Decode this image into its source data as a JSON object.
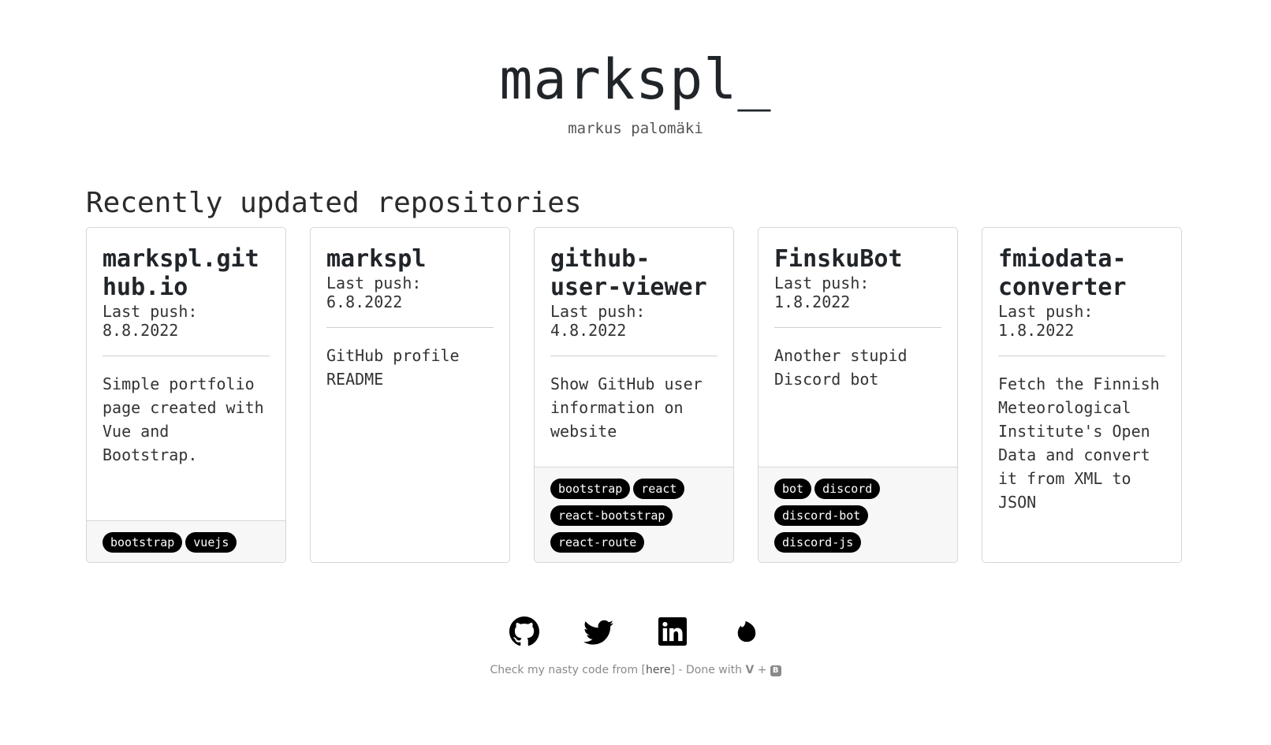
{
  "header": {
    "title": "markspl_",
    "subtitle": "markus palomäki"
  },
  "section": {
    "title": "Recently updated repositories"
  },
  "repos": [
    {
      "name": "markspl.github.io",
      "push": "Last push: 8.8.2022",
      "description": "Simple portfolio page created with Vue and Bootstrap.",
      "tags": [
        "bootstrap",
        "vuejs"
      ]
    },
    {
      "name": "markspl",
      "push": "Last push: 6.8.2022",
      "description": "GitHub profile README",
      "tags": []
    },
    {
      "name": "github-user-viewer",
      "push": "Last push: 4.8.2022",
      "description": "Show GitHub user information on website",
      "tags": [
        "bootstrap",
        "react",
        "react-bootstrap",
        "react-route"
      ]
    },
    {
      "name": "FinskuBot",
      "push": "Last push: 1.8.2022",
      "description": "Another stupid Discord bot",
      "tags": [
        "bot",
        "discord",
        "discord-bot",
        "discord-js"
      ]
    },
    {
      "name": "fmiodata-converter",
      "push": "Last push: 1.8.2022",
      "description": "Fetch the Finnish Meteorological Institute's Open Data and convert it from XML to JSON",
      "tags": []
    }
  ],
  "socials": [
    {
      "icon": "github-icon"
    },
    {
      "icon": "twitter-icon"
    },
    {
      "icon": "linkedin-icon"
    },
    {
      "icon": "tinder-icon"
    }
  ],
  "footer": {
    "prefix": "Check my nasty code from [",
    "link": "here",
    "suffix": "] - Done with",
    "plus": "+",
    "vue_symbol": "V",
    "bootstrap_symbol": "B"
  }
}
